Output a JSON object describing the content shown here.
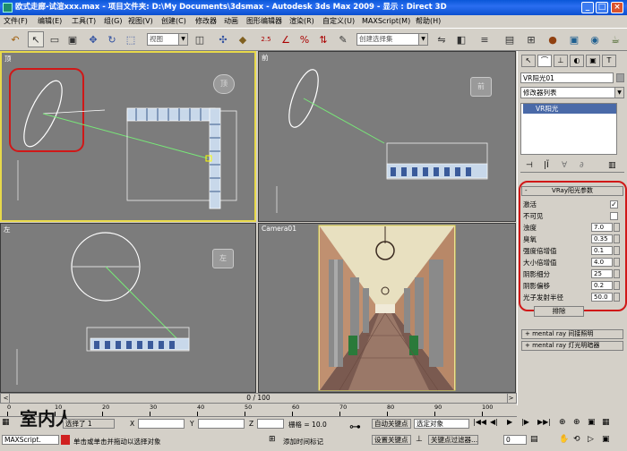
{
  "title": "欧式走廊-试渲xxx.max    - 项目文件夹: D:\\My Documents\\3dsmax    - Autodesk 3ds Max  2009         - 显示 : Direct 3D",
  "menu": [
    "文件(F)",
    "编辑(E)",
    "工具(T)",
    "组(G)",
    "视图(V)",
    "创建(C)",
    "修改器",
    "动画",
    "图形编辑器",
    "渲染(R)",
    "自定义(U)",
    "MAXScript(M)",
    "帮助(H)"
  ],
  "toolbar": {
    "view_combo": "视图",
    "selection_set": "创建选择集",
    "render_frame_icon": "render-frame-icon",
    "angle_label": "2.5",
    "percent_label": "%"
  },
  "viewports": {
    "top": {
      "label": "顶"
    },
    "front": {
      "label": "前"
    },
    "left": {
      "label": "左"
    },
    "camera": {
      "label": "Camera01"
    }
  },
  "command_panel": {
    "object_name": "VR阳光01",
    "modifier_list": "修改器列表",
    "stack_item": "VR阳光",
    "rollout_title": "VRay阳光参数",
    "params": [
      {
        "label": "激活",
        "type": "check",
        "value": "✓"
      },
      {
        "label": "不可见",
        "type": "check",
        "value": ""
      },
      {
        "label": "浊度",
        "type": "num",
        "value": "7.0"
      },
      {
        "label": "臭氧",
        "type": "num",
        "value": "0.35"
      },
      {
        "label": "强度倍增值",
        "type": "num",
        "value": "0.1"
      },
      {
        "label": "大小倍增值",
        "type": "num",
        "value": "4.0"
      },
      {
        "label": "阴影细分",
        "type": "num",
        "value": "25"
      },
      {
        "label": "阴影偏移",
        "type": "num",
        "value": "0.2"
      },
      {
        "label": "光子发射半径",
        "type": "num",
        "value": "50.0"
      }
    ],
    "exclude_label": "排除",
    "rollout2": "mental ray 间接照明",
    "rollout3": "mental ray 灯光明暗器"
  },
  "timeline": {
    "frame": "0 / 100",
    "ticks": [
      "0",
      "10",
      "20",
      "30",
      "40",
      "50",
      "60",
      "70",
      "80",
      "90",
      "100"
    ]
  },
  "status": {
    "maxscript": "MAXScript.",
    "logo_text": "室内人",
    "selected": "选择了 1",
    "x_label": "X",
    "y_label": "Y",
    "z_label": "Z",
    "grid": "栅格 = 10.0",
    "prompt": "单击或单击并拖动以选择对象",
    "add_time_tag": "添加时间标记",
    "auto_key": "自动关键点",
    "set_key": "设置关键点",
    "selected_object": "选定对象",
    "key_filter": "关键点过滤器...",
    "frame_value": "0"
  },
  "colors": {
    "viewport_bg": "#7c7c7c",
    "active_border": "#e8d94a",
    "highlight_red": "#d01818",
    "titlebar": "#0a57d8"
  }
}
